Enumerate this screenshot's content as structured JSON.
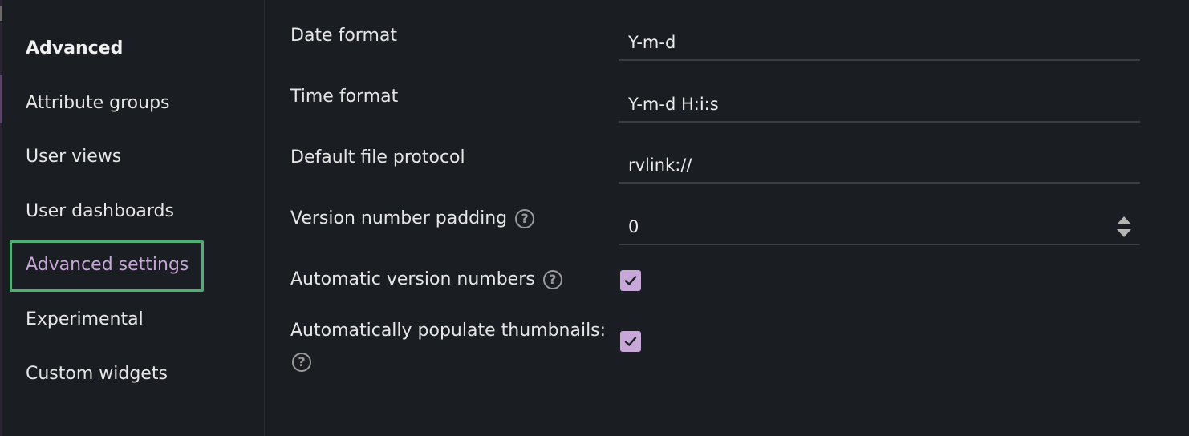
{
  "sidebar": {
    "heading": "Advanced",
    "items": [
      {
        "label": "Attribute groups"
      },
      {
        "label": "User views"
      },
      {
        "label": "User dashboards"
      },
      {
        "label": "Advanced settings",
        "active": true
      },
      {
        "label": "Experimental"
      },
      {
        "label": "Custom widgets"
      }
    ]
  },
  "form": {
    "date_format": {
      "label": "Date format",
      "value": "Y-m-d"
    },
    "time_format": {
      "label": "Time format",
      "value": "Y-m-d H:i:s"
    },
    "default_file_protocol": {
      "label": "Default file protocol",
      "value": "rvlink://"
    },
    "version_number_padding": {
      "label": "Version number padding",
      "value": "0"
    },
    "automatic_version_numbers": {
      "label": "Automatic version numbers",
      "checked": true
    },
    "automatically_populate_thumbnails": {
      "label": "Automatically populate thumbnails:",
      "checked": true
    }
  },
  "colors": {
    "accent": "#c7a6d8",
    "highlight": "#4caf73",
    "background": "#1a1d22"
  },
  "icons": {
    "help": "question-circle-icon",
    "check": "checkmark-icon",
    "spinner": "up-down-arrows-icon"
  }
}
